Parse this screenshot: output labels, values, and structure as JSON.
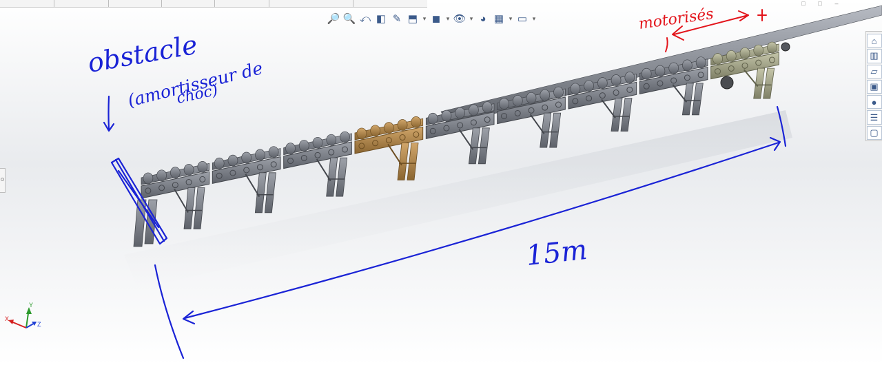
{
  "window": {
    "top_strip_ticks": 6,
    "controls": [
      "□",
      "□",
      "–"
    ]
  },
  "heads_up_toolbar": {
    "tools": [
      {
        "name": "zoom-to-fit-icon",
        "glyph": "🔎",
        "dropdown": false
      },
      {
        "name": "zoom-to-area-icon",
        "glyph": "🔍",
        "dropdown": false
      },
      {
        "name": "previous-view-icon",
        "glyph": "⤺",
        "dropdown": false
      },
      {
        "name": "section-view-icon",
        "glyph": "◧",
        "dropdown": false
      },
      {
        "name": "dynamic-annotation-icon",
        "glyph": "✎",
        "dropdown": false
      },
      {
        "name": "view-orientation-icon",
        "glyph": "⬒",
        "dropdown": true
      },
      {
        "name": "display-style-icon",
        "glyph": "◼",
        "dropdown": true
      },
      {
        "name": "hide-show-items-icon",
        "glyph": "👁",
        "dropdown": true
      },
      {
        "name": "edit-appearance-icon",
        "glyph": "◕",
        "dropdown": false
      },
      {
        "name": "apply-scene-icon",
        "glyph": "▦",
        "dropdown": true
      },
      {
        "name": "view-settings-icon",
        "glyph": "▭",
        "dropdown": true
      }
    ]
  },
  "task_pane": {
    "tabs": [
      {
        "name": "home-icon",
        "glyph": "⌂"
      },
      {
        "name": "design-library-icon",
        "glyph": "▥"
      },
      {
        "name": "file-explorer-icon",
        "glyph": "▱"
      },
      {
        "name": "view-palette-icon",
        "glyph": "▣"
      },
      {
        "name": "appearances-icon",
        "glyph": "●"
      },
      {
        "name": "custom-properties-icon",
        "glyph": "☰"
      },
      {
        "name": "forum-icon",
        "glyph": "▢"
      }
    ]
  },
  "annotations": {
    "obstacle_line1": "obstacle",
    "obstacle_line2": "(amortisseur de",
    "obstacle_line3": "choc)",
    "motorises": "motorisés",
    "length": "15m"
  },
  "colors": {
    "accent_blue": "#1a23d6",
    "accent_red": "#e3141b",
    "frame_grey": "#7c8088",
    "roller_grey": "#8e929a",
    "highlight_tan": "#b88c4f",
    "drive_khaki": "#a9a98c"
  },
  "triad": {
    "x": "X",
    "y": "Y",
    "z": "Z"
  }
}
